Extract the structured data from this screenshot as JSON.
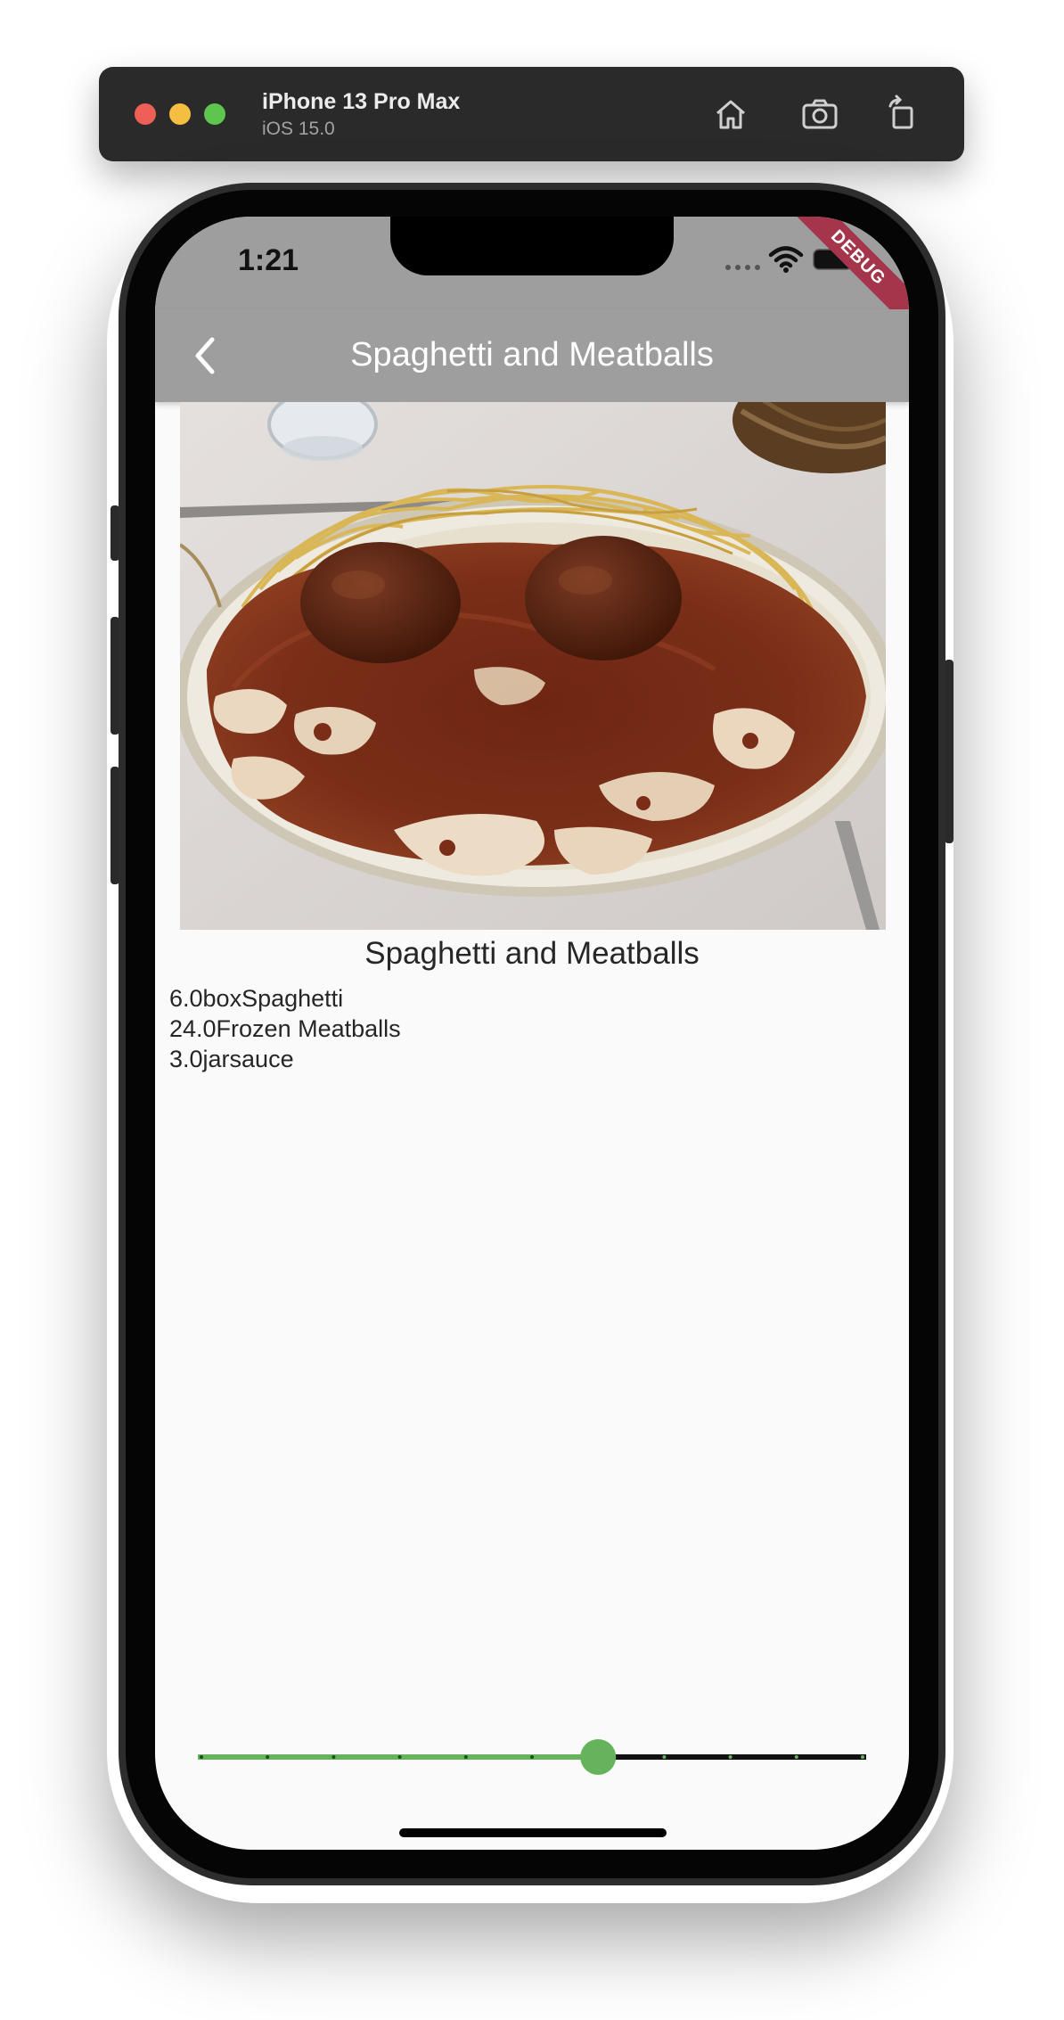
{
  "simulator": {
    "device_name": "iPhone 13 Pro Max",
    "os_version": "iOS 15.0",
    "icons": [
      "home-icon",
      "screenshot-icon",
      "rotate-icon"
    ]
  },
  "status_bar": {
    "time": "1:21",
    "debug_banner": "DEBUG"
  },
  "app_bar": {
    "title": "Spaghetti and Meatballs",
    "back_icon": "chevron-left-icon"
  },
  "recipe": {
    "name": "Spaghetti and Meatballs",
    "ingredients": [
      {
        "quantity": "6.0",
        "measure": "box",
        "name": "Spaghetti",
        "text": "6.0boxSpaghetti"
      },
      {
        "quantity": "24.0",
        "measure": "",
        "name": "Frozen Meatballs",
        "text": "24.0Frozen Meatballs"
      },
      {
        "quantity": "3.0",
        "measure": "jar",
        "name": "sauce",
        "text": "3.0jarsauce"
      }
    ]
  },
  "serving_slider": {
    "divisions": 10,
    "value_fraction": 0.6,
    "active_color": "#66b35e",
    "inactive_color": "#111111"
  },
  "colors": {
    "app_bar": "#9e9e9e",
    "background": "#fafafa",
    "debug_banner": "#a5354a"
  }
}
